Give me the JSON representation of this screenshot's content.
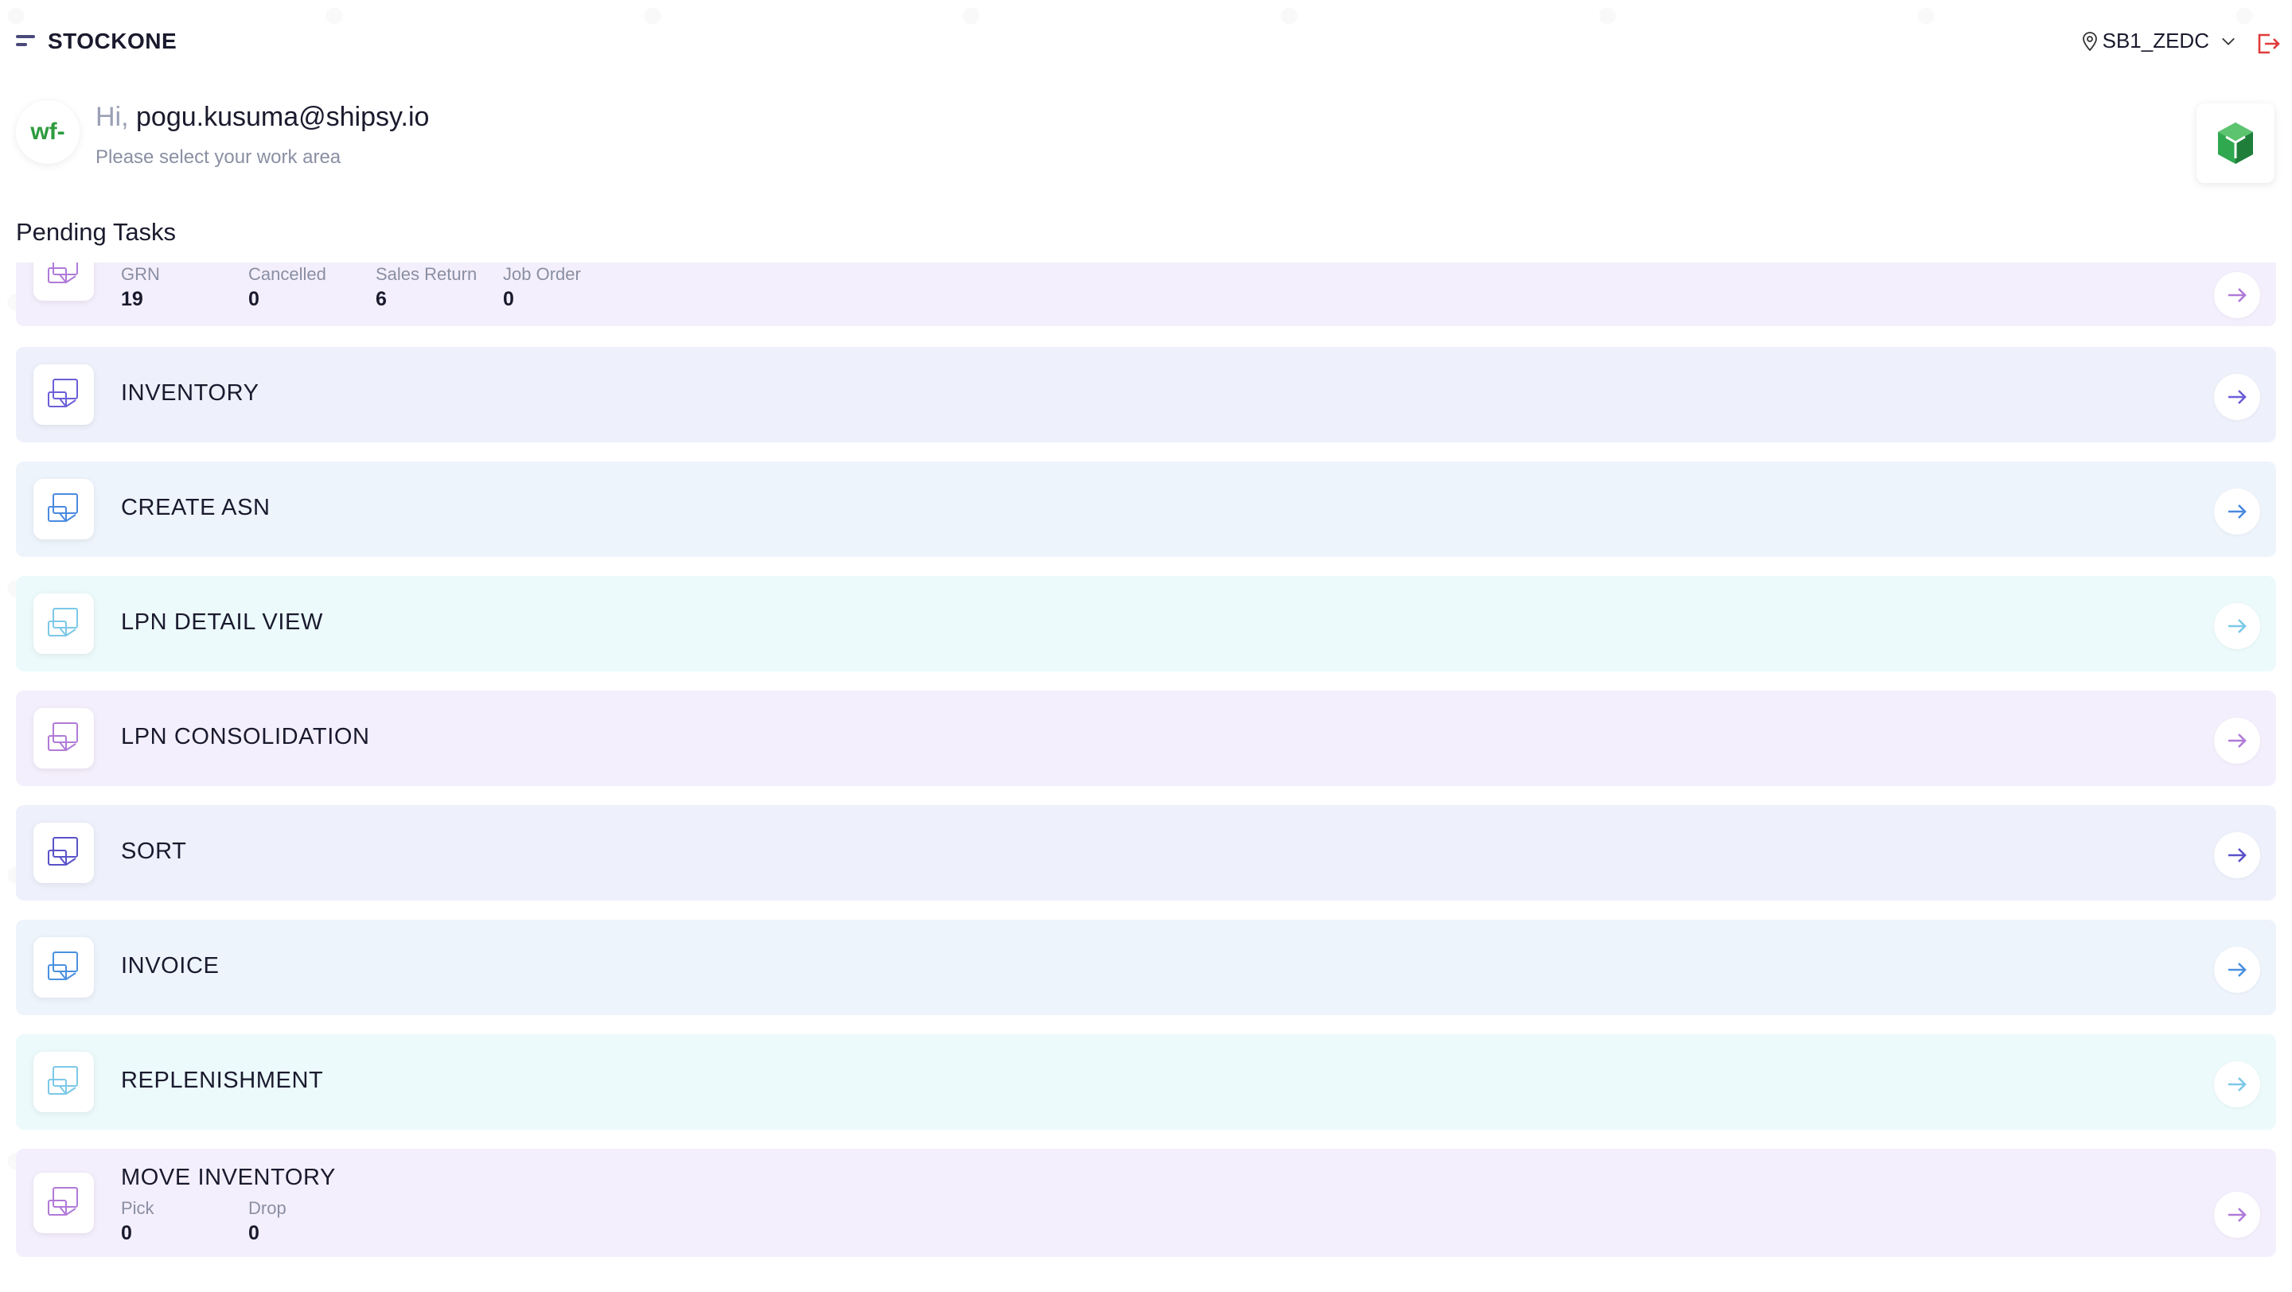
{
  "header": {
    "brand": "STOCKONE",
    "location": "SB1_ZEDC"
  },
  "greeting": {
    "avatar_text": "wf-",
    "hi": "Hi, ",
    "user": "pogu.kusuma@shipsy.io",
    "subtitle": "Please select your work area"
  },
  "section_title": "Pending Tasks",
  "pending": {
    "stats": [
      {
        "label": "GRN",
        "value": "19"
      },
      {
        "label": "Cancelled",
        "value": "0"
      },
      {
        "label": "Sales Return",
        "value": "6"
      },
      {
        "label": "Job Order",
        "value": "0"
      }
    ]
  },
  "tasks": [
    {
      "title": "INVENTORY",
      "color": "#6b5fd8"
    },
    {
      "title": "CREATE ASN",
      "color": "#4a8ae0"
    },
    {
      "title": "LPN DETAIL VIEW",
      "color": "#7cc8e8"
    },
    {
      "title": "LPN CONSOLIDATION",
      "color": "#b07ad8"
    },
    {
      "title": "SORT",
      "color": "#5a52c8"
    },
    {
      "title": "INVOICE",
      "color": "#4a90e0"
    },
    {
      "title": "REPLENISHMENT",
      "color": "#7cc8e8"
    }
  ],
  "move_inventory": {
    "title": "MOVE INVENTORY",
    "stats": [
      {
        "label": "Pick",
        "value": "0"
      },
      {
        "label": "Drop",
        "value": "0"
      }
    ]
  }
}
